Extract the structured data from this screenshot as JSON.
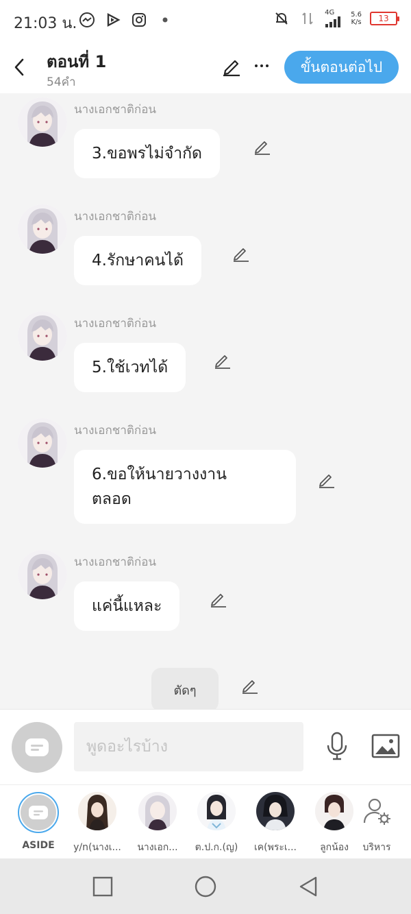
{
  "status_bar": {
    "time": "21:03 น.",
    "network": "4G",
    "speed_value": "5.6",
    "speed_unit": "K/s",
    "battery": "13",
    "icons": [
      "messenger-icon",
      "play-icon",
      "instagram-icon",
      "dot-icon",
      "bell-muted-icon",
      "data-arrows-icon",
      "signal-icon"
    ]
  },
  "header": {
    "title": "ตอนที่ 1",
    "subtitle": "54คำ",
    "next_button": "ขั้นตอนต่อไป",
    "icons": [
      "chevron-left-icon",
      "pencil-icon",
      "more-icon"
    ]
  },
  "messages": [
    {
      "sender": "นางเอกชาติก่อน",
      "text": "3.ขอพรไม่จำกัด"
    },
    {
      "sender": "นางเอกชาติก่อน",
      "text": "4.รักษาคนได้"
    },
    {
      "sender": "นางเอกชาติก่อน",
      "text": "5.ใช้เวทได้"
    },
    {
      "sender": "นางเอกชาติก่อน",
      "text": "6.ขอให้นายวางงาน\nตลอด"
    },
    {
      "sender": "นางเอกชาติก่อน",
      "text": "แค่นี้แหละ"
    }
  ],
  "narration": {
    "text": "ตัดๆ"
  },
  "input": {
    "placeholder": "พูดอะไรบ้าง"
  },
  "characters": [
    {
      "label": "ASIDE"
    },
    {
      "label": "y/n(นางเ..."
    },
    {
      "label": "นางเอก..."
    },
    {
      "label": "ต.ป.ก.(ญ)"
    },
    {
      "label": "เค(พระเ..."
    },
    {
      "label": "ลูกน้อง"
    },
    {
      "label": "บริหาร"
    }
  ],
  "nav": [
    "square-icon",
    "circle-icon",
    "triangle-back-icon"
  ],
  "colors": {
    "accent": "#4aa8ec",
    "battery": "#e0362f",
    "background": "#f4f4f4"
  }
}
